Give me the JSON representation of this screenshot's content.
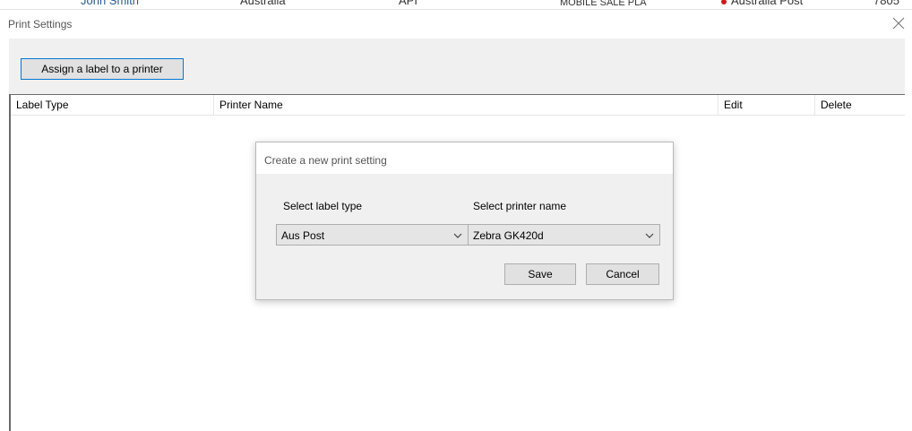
{
  "background_row": {
    "name": "John Smith",
    "country": "Australia",
    "source": "API",
    "code": "MOBILE SALE PLA",
    "carrier": "Australia Post",
    "number": "7805"
  },
  "window": {
    "title": "Print Settings",
    "close_icon": "close-icon",
    "assign_button_label": "Assign a label to a printer"
  },
  "grid": {
    "columns": [
      "Label Type",
      "Printer Name",
      "Edit",
      "Delete"
    ]
  },
  "dialog": {
    "title": "Create a new print setting",
    "label_type_label": "Select label type",
    "printer_name_label": "Select printer name",
    "label_type_value": "Aus Post",
    "printer_name_value": "Zebra GK420d",
    "save_label": "Save",
    "cancel_label": "Cancel"
  },
  "colors": {
    "accent": "#0078d7",
    "status_dot": "#d01b1b"
  }
}
